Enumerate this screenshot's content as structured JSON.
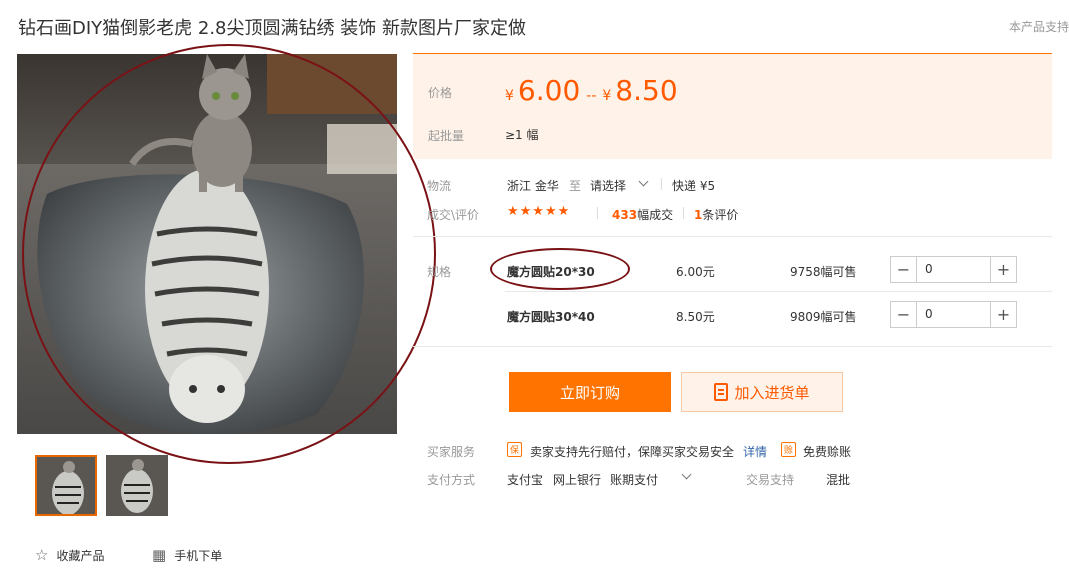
{
  "product": {
    "title": "钻石画DIY猫倒影老虎 2.8尖顶圆满钻绣 装饰 新款图片厂家定做",
    "support_hint": "本产品支持"
  },
  "price": {
    "label": "价格",
    "currency": "¥",
    "low": "6.00",
    "separator": "--",
    "high": "8.50",
    "min_batch_label": "起批量",
    "min_batch_value": "≥1 幅"
  },
  "logistics": {
    "label": "物流",
    "origin": "浙江 金华",
    "to": "至",
    "destination": "请选择",
    "express": "快递 ¥5"
  },
  "deals": {
    "label": "成交\\评价",
    "stars": "★★★★★",
    "rating_value": 5,
    "deal_count": "433",
    "deal_unit": "幅成交",
    "review_count": "1",
    "review_unit": "条评价"
  },
  "spec": {
    "label": "规格",
    "items": [
      {
        "name": "魔方圆贴20*30",
        "price": "6.00元",
        "stock": "9758幅可售",
        "qty": "0"
      },
      {
        "name": "魔方圆贴30*40",
        "price": "8.50元",
        "stock": "9809幅可售",
        "qty": "0"
      }
    ]
  },
  "actions": {
    "buy_now": "立即订购",
    "add_to_list": "加入进货单",
    "favorite": "收藏产品",
    "mobile_order": "手机下单"
  },
  "service": {
    "label": "买家服务",
    "badge1": "保",
    "text1": "卖家支持先行赔付，保障买家交易安全",
    "detail_link": "详情",
    "badge2": "赊",
    "text2": "免费赊账"
  },
  "payment": {
    "label": "支付方式",
    "methods": [
      "支付宝",
      "网上银行",
      "账期支付"
    ],
    "trade_label": "交易支持",
    "trade_value": "混批"
  },
  "colors": {
    "accent": "#ff7300",
    "price": "#ff5a00",
    "panel_bg": "#fff2e8",
    "annotation": "#7a1215"
  },
  "icons": {
    "star": "star-outline-icon",
    "mobile": "qr-code-icon",
    "cart": "clipboard-icon"
  }
}
